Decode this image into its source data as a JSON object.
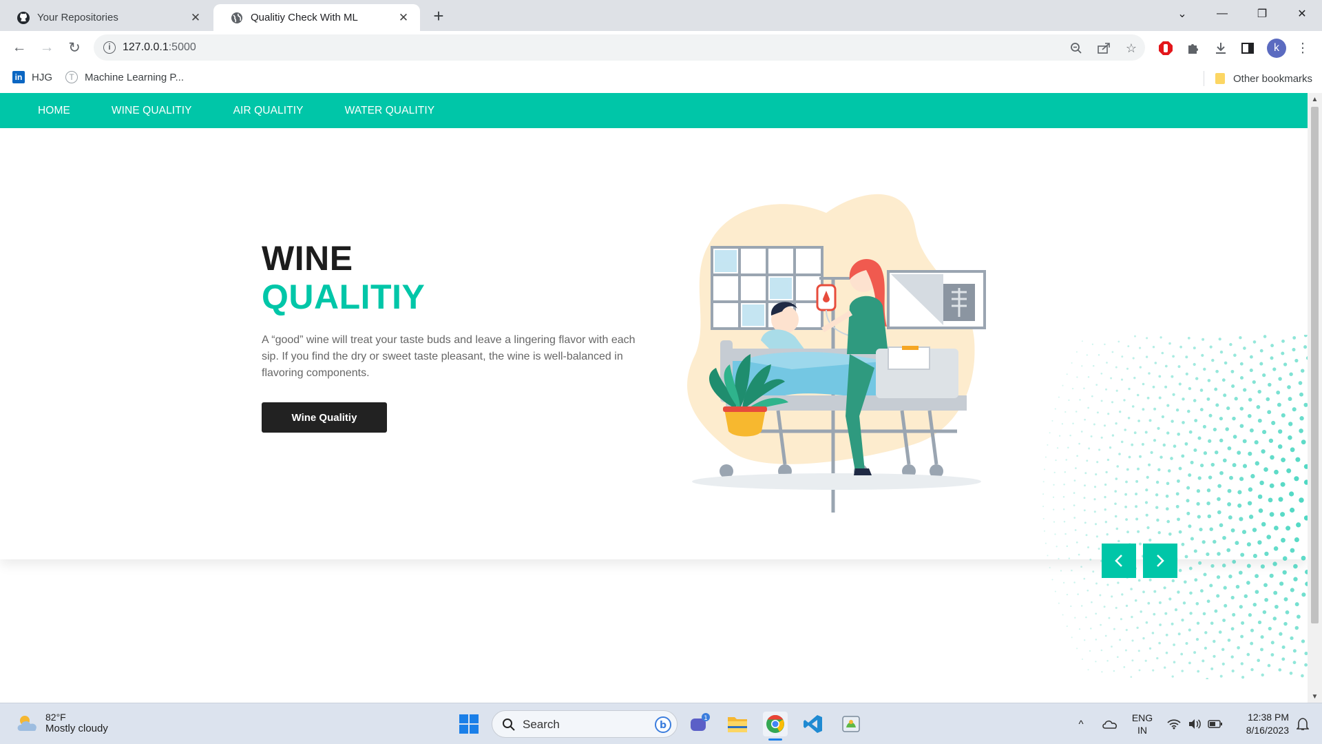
{
  "browser": {
    "tabs": [
      {
        "title": "Your Repositories",
        "favicon": "github-icon",
        "active": false
      },
      {
        "title": "Qualitiy Check With ML",
        "favicon": "globe-icon",
        "active": true
      }
    ],
    "url_host": "127.0.0.1",
    "url_port": ":5000",
    "bookmarks": [
      {
        "label": "HJG",
        "icon": "linkedin-icon"
      },
      {
        "label": "Machine Learning P...",
        "icon": "t-icon"
      }
    ],
    "other_bookmarks": "Other bookmarks",
    "profile_initial": "k"
  },
  "site": {
    "nav": [
      "HOME",
      "WINE QUALITIY",
      "AIR QUALITIY",
      "WATER QUALITIY"
    ],
    "hero": {
      "title_line1": "WINE",
      "title_line2": "QUALITIY",
      "description": "A “good” wine will treat your taste buds and leave a lingering flavor with each sip. If you find the dry or sweet taste pleasant, the wine is well-balanced in flavoring components.",
      "button_label": "Wine Qualitiy"
    },
    "colors": {
      "accent": "#00c6a8",
      "dark": "#222222",
      "text": "#666666"
    }
  },
  "taskbar": {
    "weather_temp": "82°F",
    "weather_desc": "Mostly cloudy",
    "search_label": "Search",
    "chat_badge": "1",
    "language_line1": "ENG",
    "language_line2": "IN",
    "time": "12:38 PM",
    "date": "8/16/2023"
  }
}
